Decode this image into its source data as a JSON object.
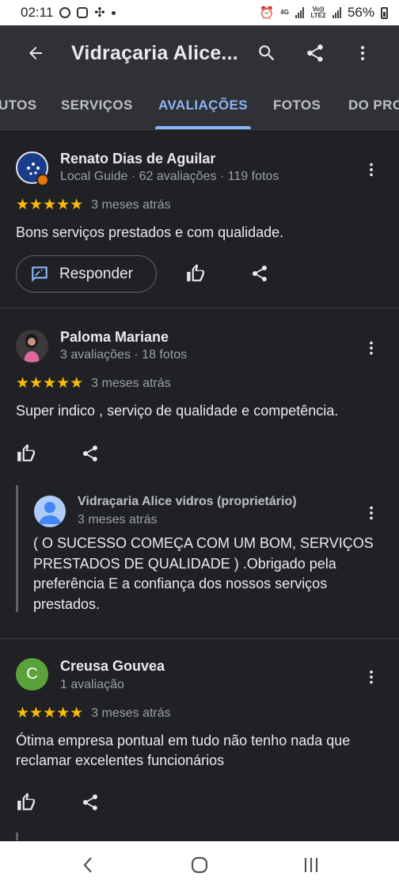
{
  "status_bar": {
    "time": "02:11",
    "network_top": "4G",
    "network_volte": "Vo)) LTE2",
    "battery": "56%"
  },
  "app_bar": {
    "title": "Vidraçaria Alice...",
    "back_icon": "arrow-back-icon",
    "search_icon": "search-icon",
    "share_icon": "share-icon",
    "more_icon": "more-vert-icon"
  },
  "tabs": [
    {
      "label": "UTOS"
    },
    {
      "label": "SERVIÇOS"
    },
    {
      "label": "AVALIAÇÕES",
      "active": true
    },
    {
      "label": "FOTOS"
    },
    {
      "label": "DO PRO"
    }
  ],
  "reviews": [
    {
      "name": "Renato Dias de Aguilar",
      "meta": "Local Guide · 62 avaliações · 119 fotos",
      "stars": "★★★★★",
      "rating": 5,
      "time": "3 meses atrás",
      "text": "Bons serviços prestados e com qualidade.",
      "reply_label": "Responder"
    },
    {
      "name": "Paloma Mariane",
      "meta": "3 avaliações · 18 fotos",
      "stars": "★★★★★",
      "rating": 5,
      "time": "3 meses atrás",
      "text": "Super indico , serviço de qualidade e competência.",
      "owner_reply": {
        "name": "Vidraçaria Alice vidros (proprietário)",
        "time": "3 meses atrás",
        "text": "( O SUCESSO COMEÇA COM UM BOM, SERVIÇOS PRESTADOS DE QUALIDADE ) .Obrigado pela preferência E a confiança dos nossos serviços prestados."
      }
    },
    {
      "name": "Creusa Gouvea",
      "initial": "C",
      "meta": "1 avaliação",
      "stars": "★★★★★",
      "rating": 5,
      "time": "3 meses atrás",
      "text": "Ótima empresa pontual em tudo não tenho nada que reclamar excelentes funcionários"
    }
  ],
  "colors": {
    "background": "#202124",
    "app_bar": "#303134",
    "accent": "#8ab4f8",
    "star": "#fbbc04",
    "avatar_green": "#5aa33b"
  }
}
